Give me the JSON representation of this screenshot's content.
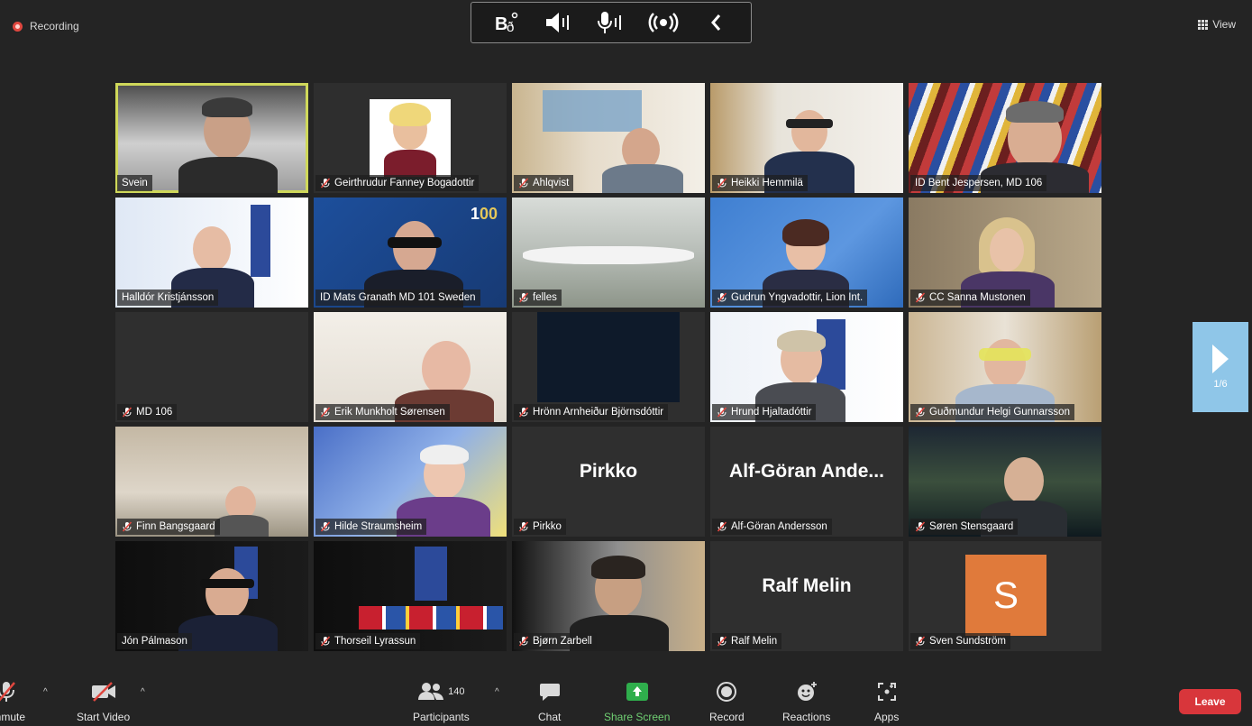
{
  "top": {
    "recording_label": "Recording",
    "view_label": "View",
    "toolbar_icons": [
      "sign-language-icon",
      "speaker-icon",
      "microphone-icon",
      "broadcast-icon",
      "collapse-chevron-icon"
    ]
  },
  "tiles": [
    {
      "name": "Svein",
      "muted": false,
      "active": true
    },
    {
      "name": "Geirthrudur Fanney Bogadottir",
      "muted": true
    },
    {
      "name": "Ahlqvist",
      "muted": true
    },
    {
      "name": "Heikki Hemmilä",
      "muted": true
    },
    {
      "name": "ID Bent Jespersen, MD 106",
      "muted": false
    },
    {
      "name": "Halldór Kristjánsson",
      "muted": false
    },
    {
      "name": "ID Mats Granath MD 101 Sweden",
      "muted": false
    },
    {
      "name": "felles",
      "muted": true
    },
    {
      "name": "Gudrun Yngvadottir, Lion Int.",
      "muted": true
    },
    {
      "name": "CC Sanna Mustonen",
      "muted": true
    },
    {
      "name": "MD 106",
      "muted": true
    },
    {
      "name": "Erik Munkholt Sørensen",
      "muted": true
    },
    {
      "name": "Hrönn Arnheiður Björnsdóttir",
      "muted": true
    },
    {
      "name": "Hrund Hjaltadóttir",
      "muted": true
    },
    {
      "name": "Guðmundur Helgi Gunnarsson",
      "muted": true
    },
    {
      "name": "Finn Bangsgaard",
      "muted": true
    },
    {
      "name": "Hilde Straumsheim",
      "muted": true
    },
    {
      "name": "Pirkko",
      "muted": true,
      "big_name": "Pirkko"
    },
    {
      "name": "Alf-Göran Andersson",
      "muted": true,
      "big_name": "Alf-Göran  Ande..."
    },
    {
      "name": "Søren Stensgaard",
      "muted": true
    },
    {
      "name": "Jón Pálmason",
      "muted": false
    },
    {
      "name": "Thorseil Lyrassun",
      "muted": true
    },
    {
      "name": "Bjørn Zarbell",
      "muted": true
    },
    {
      "name": "Ralf Melin",
      "muted": true,
      "big_name": "Ralf Melin"
    },
    {
      "name": "Sven Sundström",
      "muted": true,
      "avatar_letter": "S"
    }
  ],
  "pager": {
    "label": "1/6"
  },
  "controls": {
    "unmute": "Unmute",
    "start_video": "Start Video",
    "participants": "Participants",
    "participants_count": "140",
    "chat": "Chat",
    "share_screen": "Share Screen",
    "record": "Record",
    "reactions": "Reactions",
    "apps": "Apps",
    "leave": "Leave"
  },
  "colors": {
    "background": "#242424",
    "recording_red": "#e0473f",
    "active_speaker_border": "#cfd85a",
    "share_green": "#6fcf72",
    "leave_red": "#d8363b",
    "pager_blue": "#8fc6e8",
    "avatar_orange": "#e07a3b"
  }
}
